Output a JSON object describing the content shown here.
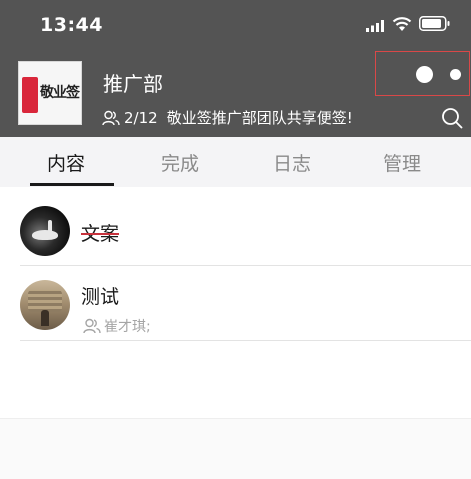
{
  "status_bar": {
    "time": "13:44"
  },
  "header": {
    "logo_text": "敬业签",
    "title": "推广部",
    "member_count": "2/12",
    "description": "敬业签推广部团队共享便签!"
  },
  "tabs": [
    {
      "label": "内容",
      "active": true
    },
    {
      "label": "完成",
      "active": false
    },
    {
      "label": "日志",
      "active": false
    },
    {
      "label": "管理",
      "active": false
    }
  ],
  "items": [
    {
      "title": "文案",
      "struck": true
    },
    {
      "title": "测试",
      "assignee": "崔才琪;"
    }
  ],
  "colors": {
    "header_bg": "#545454",
    "strike": "#c8323c",
    "capsule_border": "#d94848"
  }
}
